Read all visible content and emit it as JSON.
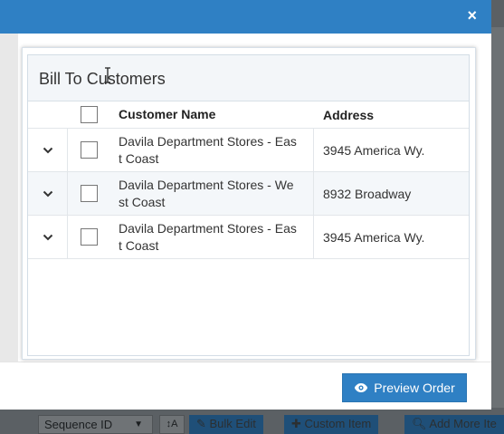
{
  "background": {
    "sequence_select": "Sequence ID",
    "sort_button": "↕A",
    "buttons": [
      {
        "label": "Bulk Edit"
      },
      {
        "label": "Custom Item"
      },
      {
        "label": "Add More Ite"
      }
    ]
  },
  "modal": {
    "close_icon": "×",
    "preview_button": {
      "label": "Preview Order",
      "icon": "eye-icon"
    },
    "panel": {
      "title": "Bill To Customers",
      "columns": [
        "",
        "",
        "Customer Name",
        "Address"
      ],
      "rows": [
        {
          "name_line1": "Davila Department Stores - Eas",
          "name_line2": "t Coast",
          "address": "3945 America Wy."
        },
        {
          "name_line1": "Davila Department Stores - We",
          "name_line2": "st Coast",
          "address": "8932 Broadway"
        },
        {
          "name_line1": "Davila Department Stores - Eas",
          "name_line2": "t Coast",
          "address": "3945 America Wy."
        }
      ]
    }
  },
  "colors": {
    "primary": "#2f80c4",
    "header_bg": "#f3f6f9",
    "alt_row": "#f4f7fa"
  }
}
